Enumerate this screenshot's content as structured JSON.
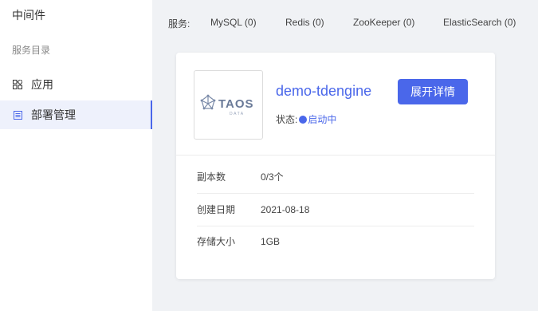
{
  "sidebar": {
    "title": "中间件",
    "section": "服务目录",
    "items": [
      {
        "label": "应用",
        "icon": "grid-icon"
      },
      {
        "label": "部署管理",
        "icon": "list-icon"
      }
    ]
  },
  "services": {
    "label": "服务:",
    "items": [
      {
        "label": "MySQL (0)"
      },
      {
        "label": "Redis (0)"
      },
      {
        "label": "ZooKeeper (0)"
      },
      {
        "label": "ElasticSearch (0)"
      }
    ]
  },
  "card": {
    "logo_text": "TAOS",
    "logo_sub": "DATA",
    "name": "demo-tdengine",
    "status_label": "状态:",
    "status_value": "启动中",
    "button_label": "展开详情",
    "info": [
      {
        "key": "副本数",
        "value": "0/3个"
      },
      {
        "key": "创建日期",
        "value": "2021-08-18"
      },
      {
        "key": "存储大小",
        "value": "1GB"
      }
    ]
  },
  "colors": {
    "accent": "#4a67ea",
    "background": "#f0f2f5"
  }
}
